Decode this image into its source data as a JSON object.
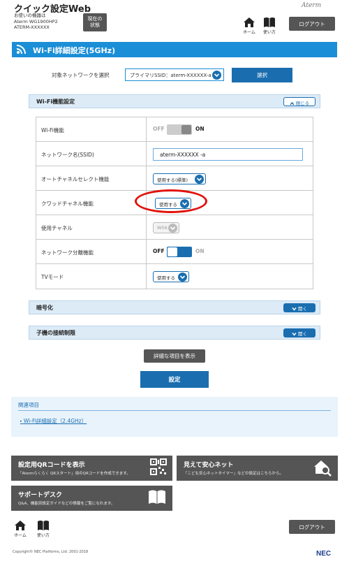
{
  "header": {
    "app_title": "クイック設定Web",
    "device_line1": "お使いの機器は",
    "device_line2": "Aterm WG1900HP2",
    "device_line3": "ATERM-XXXXXX",
    "status_line1": "現在の",
    "status_line2": "状態",
    "brand": "Aterm",
    "home_label": "ホーム",
    "howto_label": "使い方",
    "logout_label": "ログアウト"
  },
  "page": {
    "title": "Wi-Fi詳細設定(5GHz)",
    "target_network_label": "対象ネットワークを選択",
    "target_network_value": "プライマリSSID：aterm-XXXXXX-a",
    "select_button": "選択"
  },
  "wifi_section": {
    "title": "Wi-Fi機能設定",
    "collapse_label": "閉じる",
    "rows": [
      {
        "label": "Wi-Fi機能",
        "off": "OFF",
        "on": "ON"
      },
      {
        "label": "ネットワーク名(SSID)",
        "value": "aterm-XXXXXX -a"
      },
      {
        "label": "オートチャネルセレクト機能",
        "value": "使用する(標準)"
      },
      {
        "label": "クワッドチャネル機能",
        "value": "使用する"
      },
      {
        "label": "使用チャネル",
        "value": "W56"
      },
      {
        "label": "ネットワーク分離機能",
        "off": "OFF",
        "on": "ON"
      },
      {
        "label": "TVモード",
        "value": "使用する"
      }
    ]
  },
  "encryption_section": {
    "title": "暗号化",
    "expand_label": "開く"
  },
  "child_section": {
    "title": "子機の接続制限",
    "expand_label": "開く"
  },
  "buttons": {
    "show_details": "詳細な項目を表示",
    "apply": "設定"
  },
  "related": {
    "title": "関連項目",
    "link": "Wi-Fi詳細設定（2.4GHz）"
  },
  "cards": {
    "qr_title": "設定用QRコードを表示",
    "qr_desc": "「Atermらくらく QRスタート」用のQRコードを作成できます。",
    "safe_title": "見えて安心ネット",
    "safe_desc": "「こども安心ネットタイマー」などの設定はこちらから。",
    "support_title": "サポートデスク",
    "support_desc": "Q&A、機能別設定ガイドなどの情報をご覧になれます。"
  },
  "footer": {
    "copyright": "Copyright© NEC Platforms, Ltd. 2001-2018",
    "nec": "NEC"
  },
  "colors": {
    "accent_blue": "#1a8ed6",
    "button_blue": "#1a6eb0",
    "dark_button": "#555555",
    "highlight_red": "#e2120b"
  }
}
